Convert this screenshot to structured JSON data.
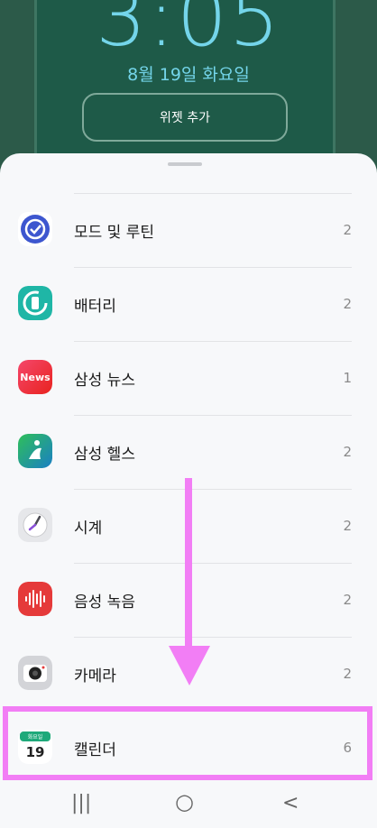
{
  "lockscreen": {
    "time": "3:05",
    "date": "8월 19일 화요일",
    "widget_button": "위젯 추가"
  },
  "apps": [
    {
      "name": "모드 및 루틴",
      "count": "2",
      "icon": "modes-routines-icon",
      "color": "#3d5bd9"
    },
    {
      "name": "배터리",
      "count": "2",
      "icon": "battery-icon",
      "color": "#1fb6a6"
    },
    {
      "name": "삼성 뉴스",
      "count": "1",
      "icon": "samsung-news-icon",
      "color": "#f03a4b",
      "badge": "News"
    },
    {
      "name": "삼성 헬스",
      "count": "2",
      "icon": "samsung-health-icon",
      "color": "#1aa88f"
    },
    {
      "name": "시계",
      "count": "2",
      "icon": "clock-icon",
      "color": "#e9e9ec"
    },
    {
      "name": "음성 녹음",
      "count": "2",
      "icon": "voice-recorder-icon",
      "color": "#e53a3a"
    },
    {
      "name": "카메라",
      "count": "2",
      "icon": "camera-icon",
      "color": "#d9dadd"
    },
    {
      "name": "캘린더",
      "count": "6",
      "icon": "calendar-icon",
      "color": "#1ea97a",
      "icon_day": "화요일",
      "icon_date": "19"
    }
  ],
  "nav": {
    "recent": "|||",
    "home": "○",
    "back": "<"
  }
}
